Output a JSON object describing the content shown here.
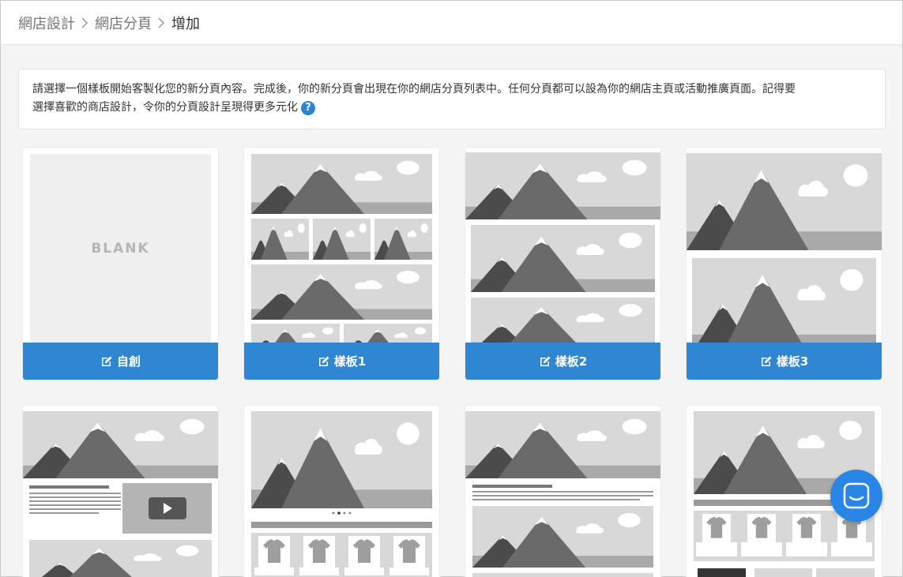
{
  "breadcrumb": {
    "items": [
      "網店設計",
      "網店分頁"
    ],
    "current": "增加"
  },
  "notice": {
    "line1": "請選擇一個樣板開始客製化您的新分頁內容。完成後，你的新分頁會出現在你的網店分頁列表中。任何分頁都可以設為你的網店主頁或活動推廣頁面。記得要",
    "line2": "選擇喜歡的商店設計，令你的分頁設計呈現得更多元化",
    "help_icon": "?"
  },
  "templates": [
    {
      "label": "自創",
      "blank_text": "BLANK"
    },
    {
      "label": "樣板1"
    },
    {
      "label": "樣板2"
    },
    {
      "label": "樣板3"
    }
  ],
  "colors": {
    "accent": "#2f87d4",
    "chat": "#2a86e6"
  },
  "icons": {
    "edit": "edit-icon",
    "help": "question-circle-icon",
    "chat": "chat-icon",
    "play": "play-icon",
    "chevron": "chevron-right-icon"
  }
}
